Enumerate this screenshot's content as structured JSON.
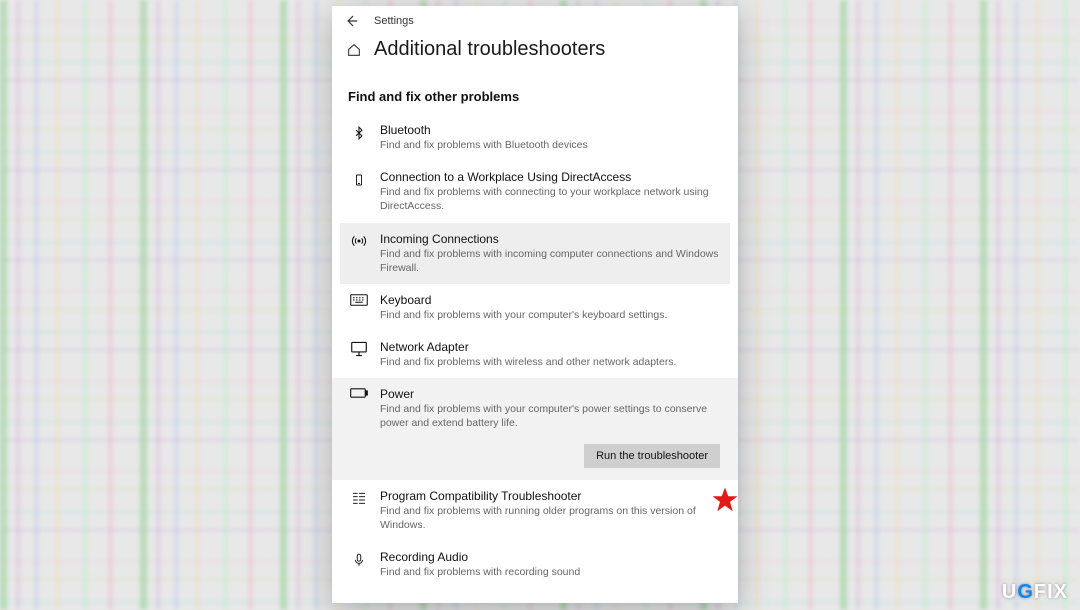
{
  "topbar": {
    "app_name": "Settings"
  },
  "page": {
    "title": "Additional troubleshooters",
    "section": "Find and fix other problems"
  },
  "items": [
    {
      "label": "Bluetooth",
      "desc": "Find and fix problems with Bluetooth devices"
    },
    {
      "label": "Connection to a Workplace Using DirectAccess",
      "desc": "Find and fix problems with connecting to your workplace network using DirectAccess."
    },
    {
      "label": "Incoming Connections",
      "desc": "Find and fix problems with incoming computer connections and Windows Firewall."
    },
    {
      "label": "Keyboard",
      "desc": "Find and fix problems with your computer's keyboard settings."
    },
    {
      "label": "Network Adapter",
      "desc": "Find and fix problems with wireless and other network adapters."
    },
    {
      "label": "Power",
      "desc": "Find and fix problems with your computer's power settings to conserve power and extend battery life."
    },
    {
      "label": "Program Compatibility Troubleshooter",
      "desc": "Find and fix problems with running older programs on this version of Windows."
    },
    {
      "label": "Recording Audio",
      "desc": "Find and fix problems with recording sound"
    }
  ],
  "buttons": {
    "run": "Run the troubleshooter"
  },
  "watermark": {
    "pre": "U",
    "mid": "G",
    "post": "FIX"
  }
}
